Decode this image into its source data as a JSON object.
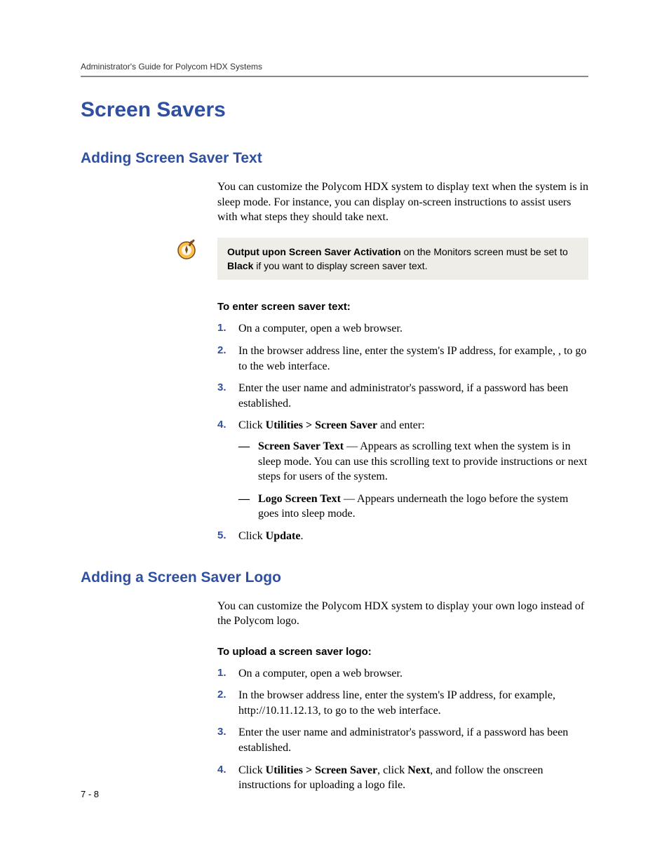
{
  "header": {
    "running": "Administrator's Guide for Polycom HDX Systems"
  },
  "title": "Screen Savers",
  "section1": {
    "heading": "Adding Screen Saver Text",
    "intro": "You can customize the Polycom HDX system to display text when the system is in sleep mode. For instance, you can display on-screen instructions to assist users with what steps they should take next.",
    "note": {
      "bold1": "Output upon Screen Saver Activation",
      "mid": " on the Monitors screen must be set to ",
      "bold2": "Black",
      "tail": " if you want to display screen saver text."
    },
    "proc_title": "To enter screen saver text:",
    "steps": {
      "s1": "On a computer, open a web browser.",
      "s2a": "In the browser address line, enter the system's IP address, for example, ",
      "s2b": ", to go to the web interface.",
      "s3": "Enter the user name and administrator's password, if a password has been established.",
      "s4a": "Click ",
      "s4b": "Utilities > Screen Saver",
      "s4c": " and enter:",
      "sub1_b": "Screen Saver Text",
      "sub1_t": " — Appears as scrolling text when the system is in sleep mode. You can use this scrolling text to provide instructions or next steps for users of the system.",
      "sub2_b": "Logo Screen Text",
      "sub2_t": " — Appears underneath the logo before the system goes into sleep mode.",
      "s5a": "Click ",
      "s5b": "Update",
      "s5c": "."
    }
  },
  "section2": {
    "heading": "Adding a Screen Saver Logo",
    "intro": "You can customize the Polycom HDX system to display your own logo instead of the Polycom logo.",
    "proc_title": "To upload a screen saver logo:",
    "steps": {
      "s1": "On a computer, open a web browser.",
      "s2": "In the browser address line, enter the system's IP address, for example, http://10.11.12.13, to go to the web interface.",
      "s3": "Enter the user name and administrator's password, if a password has been established.",
      "s4a": "Click ",
      "s4b": "Utilities > Screen Saver",
      "s4c": ", click ",
      "s4d": "Next",
      "s4e": ", and follow the onscreen instructions for uploading a logo file."
    }
  },
  "page_number": "7 - 8"
}
